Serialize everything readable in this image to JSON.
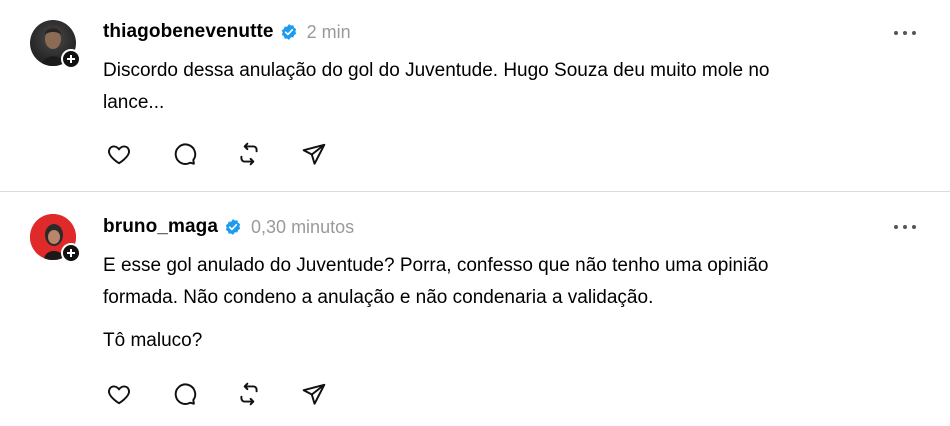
{
  "posts": [
    {
      "username": "thiagobenevenutte",
      "time": "2 min",
      "text_lines": [
        "Discordo dessa anulação do gol do Juventude. Hugo Souza deu muito mole no",
        "lance..."
      ]
    },
    {
      "username": "bruno_maga",
      "time": "0,30 minutos",
      "paragraphs": [
        [
          "E esse gol anulado do Juventude? Porra, confesso que não tenho uma opinião",
          "formada. Não condeno a anulação e não condenaria a validação."
        ],
        [
          "Tô maluco?"
        ]
      ]
    }
  ],
  "colors": {
    "verified": "#1d9bf0",
    "muted": "#9a9a9a",
    "avatar2_bg": "#e02a2a"
  },
  "icons": [
    "heart-icon",
    "comment-icon",
    "repost-icon",
    "share-icon",
    "more-icon",
    "verified-badge-icon",
    "follow-plus-icon"
  ]
}
